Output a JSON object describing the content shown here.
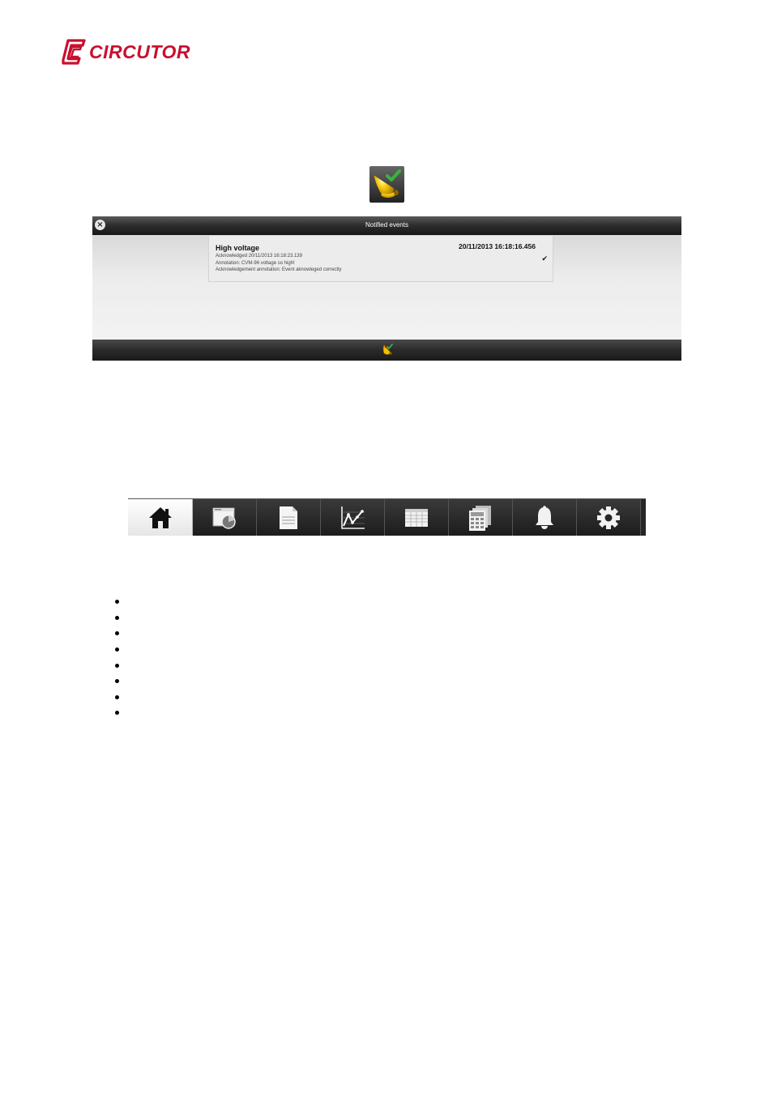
{
  "logo": {
    "text": "CIRCUTOR",
    "color": "#c8102e"
  },
  "panel": {
    "title": "Notified events",
    "event": {
      "name": "High voltage",
      "timestamp": "20/11/2013 16:18:16.456",
      "acknowledged": "Acknowledged 20/11/2013 16:18:23.139",
      "annotation": "Annotation: CVM-96 voltage so high!",
      "ack_annotation": "Acknowledgement annotation: Event aknowleged correctly"
    }
  },
  "navbar": {
    "items": [
      {
        "icon": "home-icon",
        "active": true
      },
      {
        "icon": "display-icon",
        "active": false
      },
      {
        "icon": "document-icon",
        "active": false
      },
      {
        "icon": "chart-icon",
        "active": false
      },
      {
        "icon": "table-icon",
        "active": false
      },
      {
        "icon": "calculator-icon",
        "active": false
      },
      {
        "icon": "bell-icon",
        "active": false
      },
      {
        "icon": "gear-icon",
        "active": false
      }
    ]
  },
  "bullets": {
    "count": 8
  },
  "colors": {
    "accent": "#c8102e",
    "bell": "#f2c200",
    "check": "#3cb043"
  }
}
